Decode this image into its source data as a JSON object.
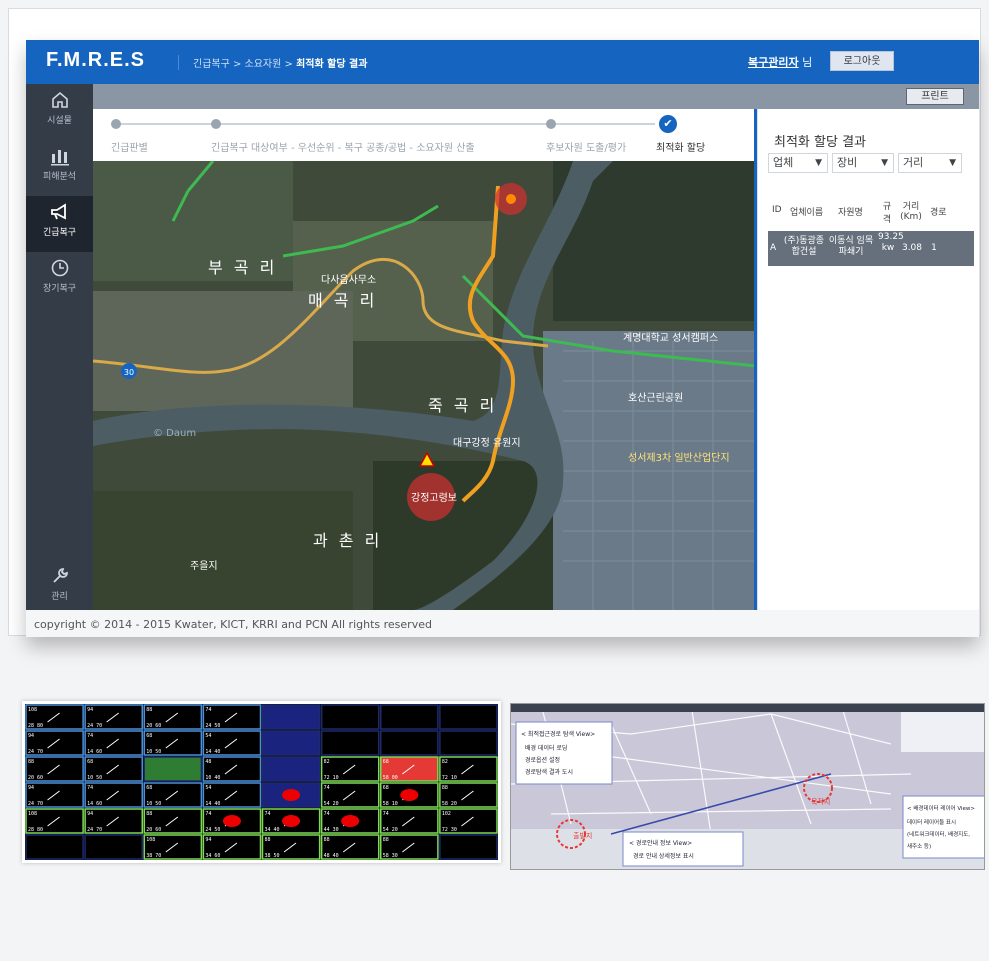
{
  "app": {
    "logo": "F.M.R.E.S",
    "breadcrumb_prefix": "긴급복구 > 소요자원 > ",
    "breadcrumb_current": "최적화 할당 결과",
    "user_name": "복구관리자",
    "user_suffix": " 님",
    "logout_label": "로그아웃",
    "print_label": "프린트"
  },
  "sidebar": {
    "items": [
      {
        "label": "시설물",
        "icon": "home-icon"
      },
      {
        "label": "피해분석",
        "icon": "bar-chart-icon"
      },
      {
        "label": "긴급복구",
        "icon": "megaphone-icon",
        "active": true
      },
      {
        "label": "장기복구",
        "icon": "clock-icon"
      },
      {
        "label": "관리",
        "icon": "wrench-icon"
      }
    ]
  },
  "steps": [
    {
      "label": "긴급판별"
    },
    {
      "label": "긴급복구 대상여부 - 우선순위 - 복구 공종/공법 - 소요자원 산출"
    },
    {
      "label": "후보자원 도출/평가"
    },
    {
      "label": "최적화 할당",
      "current": true
    }
  ],
  "map_labels": {
    "bukgokri": "부 곡 리",
    "maegokri": "매 곡 리",
    "jukgokri": "죽 곡 리",
    "gwachonri": "과 촌 리",
    "dasa_office": "다사읍사무소",
    "keimyung": "계명대학교\n성서캠퍼스",
    "park": "호산근린공원",
    "industrial": "성서제3차\n일반산업단지",
    "weir": "강정보",
    "weir_label": "강정고령보",
    "daegu": "대구강정\n유원지",
    "juelji": "주을지",
    "daum": "© Daum",
    "road30": "30"
  },
  "result_panel": {
    "title": "최적화 할당 결과",
    "filters": [
      {
        "value": "업체"
      },
      {
        "value": "장비"
      },
      {
        "value": "거리"
      }
    ],
    "headers": [
      "ID",
      "업체이름",
      "자원명",
      "규격",
      "거리(Km)",
      "경로"
    ],
    "rows": [
      {
        "id": "A",
        "company": "(주)동광종합건설",
        "resource": "이동식 임목파쇄기",
        "spec": "93.25 kw",
        "distance": "3.08",
        "route": "1"
      }
    ]
  },
  "footer": "copyright © 2014 - 2015 Kwater, KICT, KRRI and PCN All rights reserved",
  "grid_image": {
    "cells": [
      [
        "108|28 80",
        "94|24 70",
        "88|20 60",
        "74|24 50",
        "",
        "",
        "",
        ""
      ],
      [
        "94|24 70",
        "74|14 60",
        "68|10 50",
        "54|14 40",
        "",
        "",
        "",
        ""
      ],
      [
        "88|20 60",
        "68|10 50",
        "",
        "48|10 40",
        "",
        "82|72 10",
        "68|58 00",
        "82|72 10"
      ],
      [
        "94|24 70",
        "74|14 60",
        "68|10 50",
        "54|14 40",
        "",
        "74|54 20",
        "68|58 10",
        "88|58 20"
      ],
      [
        "108|28 80",
        "94|24 70",
        "88|20 60",
        "74|24 50",
        "74|34 40",
        "74|44 30",
        "74|54 20",
        "102|72 30"
      ],
      [
        "",
        "",
        "108|38 70",
        "94|34 60",
        "88|38 50",
        "88|48 40",
        "88|58 30",
        ""
      ]
    ]
  },
  "route_image": {
    "box1_title": "< 최적접근경로 탐색 View>",
    "box1_items": [
      "배경 데이터 로딩",
      "경로옵션 설정",
      "경로탐색 결과 도시"
    ],
    "box2_title": "< 배경데이터 레이어 View>",
    "box2_items": [
      "데이터 레이어들 표시",
      "(네트워크데이터, 배경지도,",
      "새주소 등)"
    ],
    "box3_title": "< 경로안내 정보 View>",
    "box3_items": [
      "경로 안내 상세정보 표시"
    ],
    "start": "출발지",
    "dest": "목적지"
  }
}
